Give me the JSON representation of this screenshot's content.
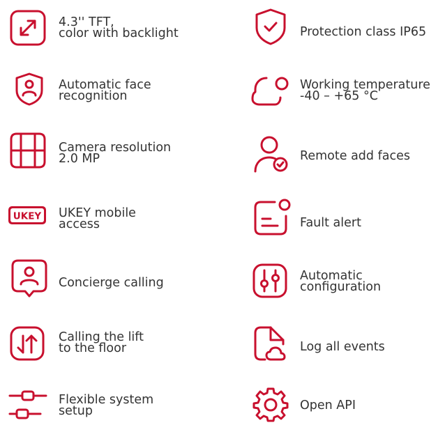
{
  "accent_color": "#C8102E",
  "text_color": "#333333",
  "left_features": [
    {
      "icon": "screen-expand-icon",
      "lines": [
        "4.3'' TFT,",
        "color with backlight"
      ]
    },
    {
      "icon": "face-shield-icon",
      "lines": [
        "Automatic face",
        "recognition"
      ]
    },
    {
      "icon": "camera-grid-icon",
      "lines": [
        "Camera resolution",
        "2.0 MP"
      ]
    },
    {
      "icon": "ukey-badge-icon",
      "badge_text": "UKEY",
      "lines": [
        "UKEY mobile",
        "access"
      ]
    },
    {
      "icon": "concierge-icon",
      "lines": [
        "Concierge calling"
      ]
    },
    {
      "icon": "lift-arrows-icon",
      "lines": [
        "Calling the lift",
        "to the floor"
      ]
    },
    {
      "icon": "system-setup-icon",
      "lines": [
        "Flexible system",
        "setup"
      ]
    }
  ],
  "right_features": [
    {
      "icon": "shield-check-icon",
      "lines": [
        "Protection class IP65"
      ]
    },
    {
      "icon": "cloud-temperature-icon",
      "lines": [
        "Working temperature",
        "-40 – +65 °C"
      ]
    },
    {
      "icon": "user-check-icon",
      "lines": [
        "Remote add faces"
      ]
    },
    {
      "icon": "fault-alert-icon",
      "lines": [
        "Fault alert"
      ]
    },
    {
      "icon": "sliders-icon",
      "lines": [
        "Automatic",
        "configuration"
      ]
    },
    {
      "icon": "log-document-icon",
      "lines": [
        "Log all events"
      ]
    },
    {
      "icon": "gear-icon",
      "lines": [
        "Open API"
      ]
    }
  ]
}
